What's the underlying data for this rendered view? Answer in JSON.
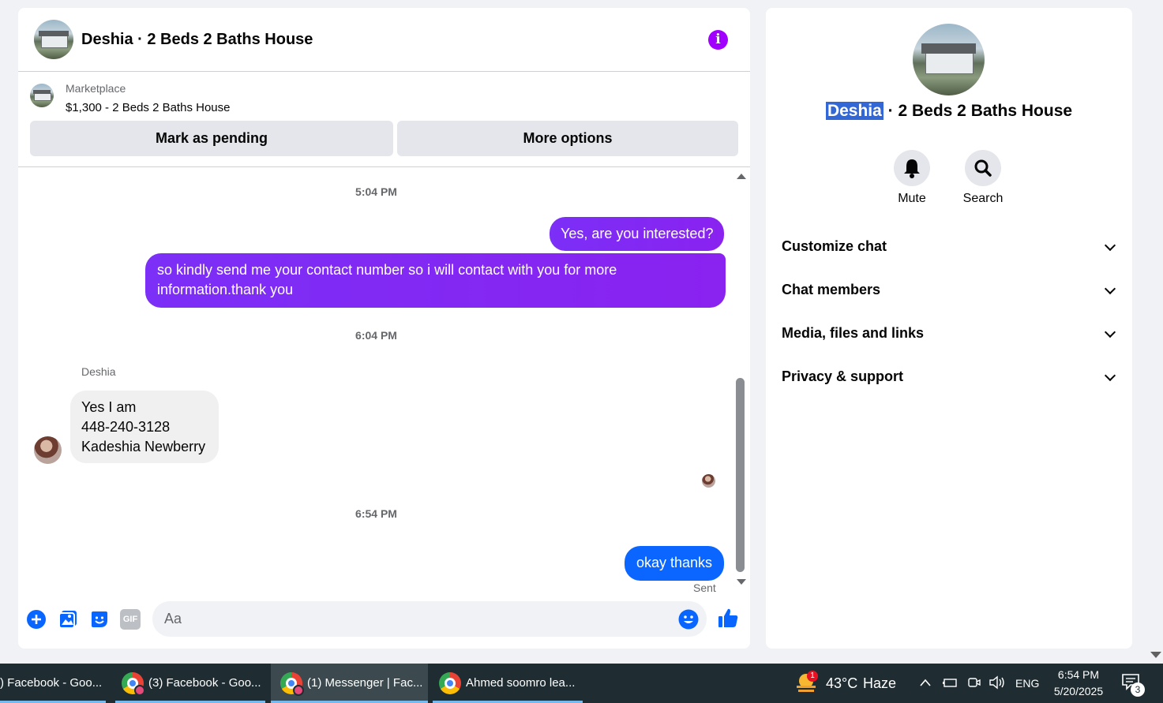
{
  "chat": {
    "title": "Deshia · 2 Beds 2 Baths House",
    "listing": {
      "source": "Marketplace",
      "price_title": "$1,300 - 2 Beds 2 Baths House",
      "mark_pending_label": "Mark as pending",
      "more_options_label": "More options"
    },
    "messages": [
      {
        "type": "timestamp",
        "text": "5:04 PM"
      },
      {
        "type": "outgoing",
        "text": "Yes, are you interested?"
      },
      {
        "type": "outgoing",
        "text": "so kindly send me your contact number so i will contact with you for more information.thank you"
      },
      {
        "type": "timestamp",
        "text": "6:04 PM"
      },
      {
        "type": "sender",
        "text": "Deshia"
      },
      {
        "type": "incoming",
        "lines": [
          "Yes I am",
          "448-240-3128",
          "Kadeshia Newberry"
        ]
      },
      {
        "type": "timestamp",
        "text": "6:54 PM"
      },
      {
        "type": "outgoing",
        "text": "okay thanks"
      },
      {
        "type": "status",
        "text": "Sent"
      }
    ],
    "composer": {
      "placeholder": "Aa",
      "gif_label": "GIF"
    },
    "colors": {
      "outgoing_purple": "#7b2ff7",
      "outgoing_blue": "#0a66ff",
      "accent": "#0866ff",
      "info_purple": "#a100ff"
    }
  },
  "info_panel": {
    "name_highlight": "Deshia",
    "name_rest": " · 2 Beds 2 Baths House",
    "actions": [
      {
        "label": "Mute",
        "icon": "bell-icon"
      },
      {
        "label": "Search",
        "icon": "search-icon"
      }
    ],
    "sections": [
      "Customize chat",
      "Chat members",
      "Media, files and links",
      "Privacy & support"
    ]
  },
  "taskbar": {
    "tasks": [
      {
        "label": ") Facebook - Goo...",
        "active": false
      },
      {
        "label": "(3) Facebook - Goo...",
        "active": false
      },
      {
        "label": "(1) Messenger | Fac...",
        "active": true
      },
      {
        "label": "Ahmed soomro lea...",
        "active": false
      }
    ],
    "weather": {
      "temp": "43°C",
      "condition": "Haze",
      "badge": "1"
    },
    "language": "ENG",
    "time": "6:54 PM",
    "date": "5/20/2025",
    "notification_count": "3"
  }
}
